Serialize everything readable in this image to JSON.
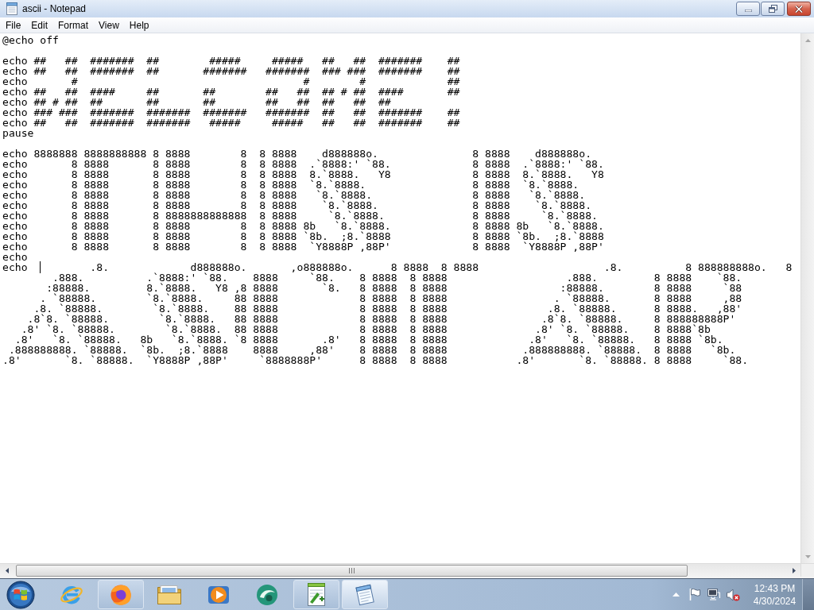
{
  "window": {
    "title": "ascii - Notepad"
  },
  "menu": [
    "File",
    "Edit",
    "Format",
    "View",
    "Help"
  ],
  "editor": {
    "lines": [
      {
        "text": "@echo off",
        "caret": false
      },
      {
        "caret": false
      },
      {
        "text": "echo ##   ##  #######  ##        #####     #####   ##   ##  #######    ##",
        "caret": false
      },
      {
        "text": "echo ##   ##  #######  ##       #######   #######  ### ###  #######    ##",
        "caret": false
      },
      {
        "text": "echo       #                                    #        #             ##",
        "caret": false
      },
      {
        "text": "echo ##   ##  ####     ##       ##        ##   ##  ## # ##  ####       ##",
        "caret": false
      },
      {
        "text": "echo ## # ##  ##       ##       ##        ##   ##  ##   ##  ##",
        "caret": false
      },
      {
        "text": "echo ### ###  #######  #######  #######   #######  ##   ##  #######    ##",
        "caret": false
      },
      {
        "text": "echo ##   ##  #######  #######   #####     #####   ##   ##  #######    ##",
        "caret": false
      },
      {
        "text": "pause",
        "caret": false
      },
      {
        "caret": false
      },
      {
        "text": "echo 8888888 8888888888 8 8888        8  8 8888    d888888o.               8 8888    d888888o.",
        "caret": false
      },
      {
        "text": "echo       8 8888       8 8888        8  8 8888  .`8888:' `88.             8 8888  .`8888:' `88.",
        "caret": false
      },
      {
        "text": "echo       8 8888       8 8888        8  8 8888  8.`8888.   Y8             8 8888  8.`8888.   Y8",
        "caret": false
      },
      {
        "text": "echo       8 8888       8 8888        8  8 8888  `8.`8888.                 8 8888  `8.`8888.",
        "caret": false
      },
      {
        "text": "echo       8 8888       8 8888        8  8 8888   `8.`8888.                8 8888   `8.`8888.",
        "caret": false
      },
      {
        "text": "echo       8 8888       8 8888        8  8 8888    `8.`8888.               8 8888    `8.`8888.",
        "caret": false
      },
      {
        "text": "echo       8 8888       8 8888888888888  8 8888     `8.`8888.              8 8888     `8.`8888.",
        "caret": false
      },
      {
        "text": "echo       8 8888       8 8888        8  8 8888 8b   `8.`8888.             8 8888 8b   `8.`8888.",
        "caret": false
      },
      {
        "text": "echo       8 8888       8 8888        8  8 8888 `8b.  ;8.`8888             8 8888 `8b.  ;8.`8888",
        "caret": false
      },
      {
        "text": "echo       8 8888       8 8888        8  8 8888  `Y8888P ,88P'             8 8888  `Y8888P ,88P'",
        "caret": false
      },
      {
        "text": "echo",
        "caret": false
      },
      {
        "text": "echo          .8.             d888888o.       ,o888888o.      8 8888  8 8888                    .8.          8 888888888o.   8",
        "caret": true
      },
      {
        "text": "        .888.          .`8888:' `88.    8888     `88.    8 8888  8 8888                   .888.         8 8888    `88.",
        "caret": false
      },
      {
        "text": "       :88888.         8.`8888.   Y8 ,8 8888       `8.   8 8888  8 8888                  :88888.        8 8888     `88",
        "caret": false
      },
      {
        "text": "      . `88888.        `8.`8888.     88 8888             8 8888  8 8888                 . `88888.       8 8888     ,88",
        "caret": false
      },
      {
        "text": "     .8. `88888.        `8.`8888.    88 8888             8 8888  8 8888                .8. `88888.      8 8888.   ,88'",
        "caret": false
      },
      {
        "text": "    .8`8. `88888.        `8.`8888.   88 8888             8 8888  8 8888               .8`8. `88888.     8 888888888P'",
        "caret": false
      },
      {
        "text": "   .8' `8. `88888.        `8.`8888.  88 8888             8 8888  8 8888              .8' `8. `88888.    8 8888`8b",
        "caret": false
      },
      {
        "text": "  .8'   `8. `88888.   8b   `8.`8888. `8 8888       .8'   8 8888  8 8888             .8'   `8. `88888.   8 8888 `8b.",
        "caret": false
      },
      {
        "text": " .888888888. `88888.  `8b.  ;8.`8888    8888     ,88'    8 8888  8 8888            .888888888. `88888.  8 8888   `8b.",
        "caret": false
      },
      {
        "text": ".8'       `8. `88888.  `Y8888P ,88P'     `8888888P'      8 8888  8 8888           .8'       `8. `88888. 8 8888     `88.",
        "caret": false
      }
    ]
  },
  "taskbar": {
    "items": [
      {
        "running": false,
        "selected": false
      },
      {
        "running": true,
        "selected": false
      },
      {
        "running": false,
        "selected": false
      },
      {
        "running": false,
        "selected": false
      },
      {
        "running": false,
        "selected": false
      },
      {
        "running": true,
        "selected": false
      },
      {
        "running": true,
        "selected": true
      }
    ],
    "tray": {
      "volume_muted": true
    },
    "clock": {
      "time": "12:43 PM",
      "date": "4/30/2024"
    }
  }
}
